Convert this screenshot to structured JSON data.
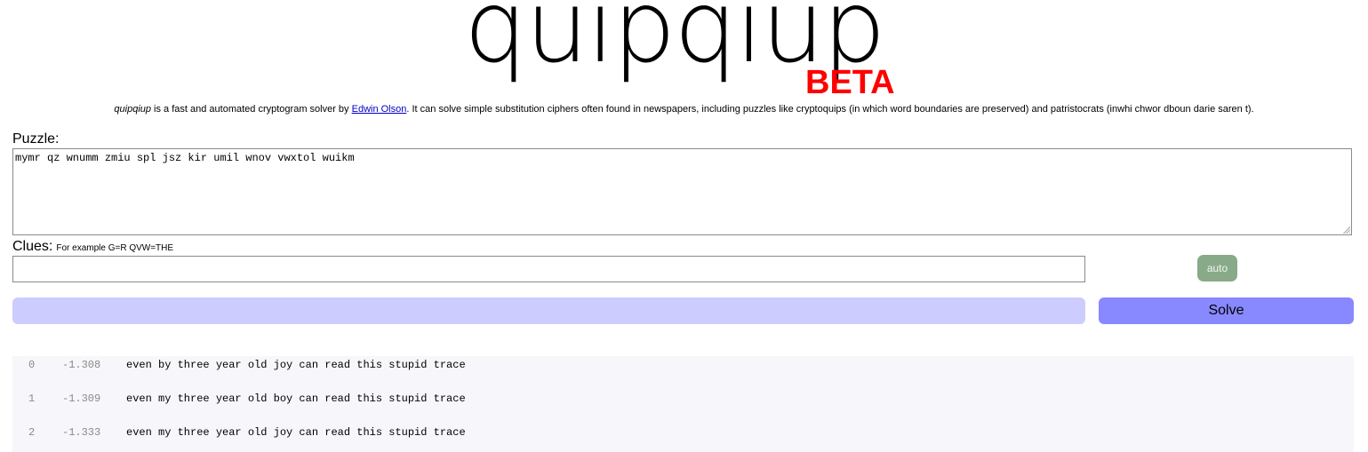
{
  "header": {
    "logo_text": "quipqiup",
    "beta_label": "BETA"
  },
  "description": {
    "app_name": "quipqiup",
    "text_before_link": " is a fast and automated cryptogram solver by ",
    "author_link": "Edwin Olson",
    "text_after_link": ". It can solve simple substitution ciphers often found in newspapers, including puzzles like cryptoquips (in which word boundaries are preserved) and patristocrats (inwhi chwor dboun darie saren t)."
  },
  "puzzle": {
    "label": "Puzzle:",
    "value": "mymr qz wnumm zmiu spl jsz kir umil wnov vwxtol wuikm"
  },
  "clues": {
    "label": "Clues:",
    "hint": "For example G=R QVW=THE",
    "value": ""
  },
  "buttons": {
    "auto_label": "auto",
    "solve_label": "Solve"
  },
  "colors": {
    "beta": "#ff0000",
    "link": "#0000cc",
    "auto_button": "#88aa88",
    "progress_bar": "#ccccff",
    "solve_button": "#8888ff",
    "results_background": "#f7f7fb"
  },
  "results": [
    {
      "index": "0",
      "score": "-1.308",
      "text": "even by three year old joy can read this stupid trace"
    },
    {
      "index": "1",
      "score": "-1.309",
      "text": "even my three year old boy can read this stupid trace"
    },
    {
      "index": "2",
      "score": "-1.333",
      "text": "even my three year old joy can read this stupid trace"
    }
  ]
}
